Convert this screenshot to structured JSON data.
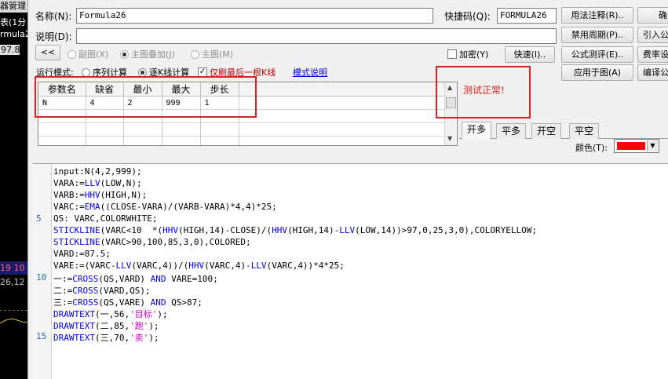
{
  "background_app": {
    "title": "器管理",
    "info_line": "表(1分",
    "formula_name": "rmula2",
    "value_box": "97.8",
    "nums_line1": "19 10",
    "nums_line2": "26,12"
  },
  "form": {
    "name_label": "名称(N):",
    "name_value": "Formula26",
    "shortcut_label": "快捷码(Q):",
    "shortcut_value": "FORMULA26",
    "desc_label": "说明(D):",
    "desc_value": ""
  },
  "buttons": {
    "collapse": "<<",
    "fast": "快速(I)..",
    "usage_note": "用法注释(R)..",
    "confirm": "确",
    "ban_period": "禁用周期(P)..",
    "import": "引入公",
    "formula_test": "公式测评(E)..",
    "fee_rate": "费率设",
    "apply_to_chart": "应用于图(A)",
    "compile": "编译公",
    "mode_help": "模式说明"
  },
  "chart_type_radios": [
    {
      "label": "副图(X)",
      "selected": false
    },
    {
      "label": "主图叠加(J)",
      "selected": true
    },
    {
      "label": "主图(M)",
      "selected": false
    }
  ],
  "encrypt_checkbox": {
    "label": "加密(Y)",
    "checked": false
  },
  "run_mode": {
    "label": "运行模式:",
    "options": [
      {
        "label": "序列计算",
        "selected": false
      },
      {
        "label": "逐K线计算",
        "selected": true
      }
    ],
    "only_last_checkbox": {
      "label": "仅刷最后一根K线",
      "checked": true
    }
  },
  "param_table": {
    "headers": [
      "参数名",
      "缺省",
      "最小",
      "最大",
      "步长"
    ],
    "rows": [
      [
        "N",
        "4",
        "2",
        "999",
        "1"
      ]
    ]
  },
  "test_status": "测试正常!",
  "tabs": [
    {
      "label": "开多",
      "active": true
    },
    {
      "label": "平多",
      "active": false
    },
    {
      "label": "开空",
      "active": false
    },
    {
      "label": "平空",
      "active": false
    }
  ],
  "color_picker": {
    "label": "颜色(T):",
    "value": "#ff0000"
  },
  "code": {
    "line_numbers": [
      "5",
      "10",
      "15"
    ],
    "lines": [
      "input:N(4,2,999);",
      "VARA:=LLV(LOW,N);",
      "VARB:=HHV(HIGH,N);",
      "VARC:=EMA((CLOSE-VARA)/(VARB-VARA)*4,4)*25;",
      "QS: VARC,COLORWHITE;",
      "STICKLINE(VARC<10  *(HHV(HIGH,14)-CLOSE)/(HHV(HIGH,14)-LLV(LOW,14))>97,0,25,3,0),COLORYELLOW;",
      "STICKLINE(VARC>90,100,85,3,0),COLORED;",
      "VARD:=87.5;",
      "VARE:=(VARC-LLV(VARC,4))/(HHV(VARC,4)-LLV(VARC,4))*4*25;",
      "一:=CROSS(QS,VARD) AND VARE=100;",
      "二:=CROSS(VARD,QS);",
      "三:=CROSS(QS,VARE) AND QS>87;",
      "DRAWTEXT(一,56,'目标');",
      "DRAWTEXT(二,85,'跑');",
      "DRAWTEXT(三,70,'卖');"
    ]
  }
}
